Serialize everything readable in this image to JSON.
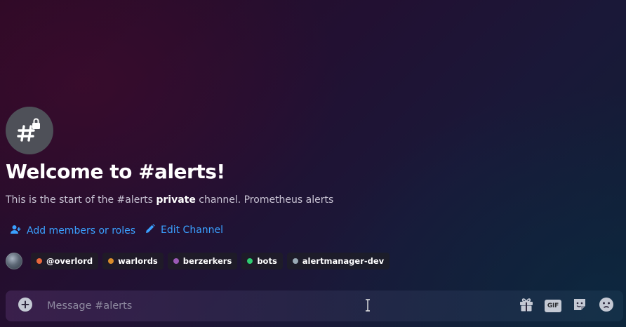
{
  "channel": {
    "name": "alerts",
    "icon": "hash-lock-icon",
    "welcome_title": "Welcome to #alerts!",
    "description_before": "This is the start of the #alerts ",
    "description_bold": "private",
    "description_after": " channel. Prometheus alerts"
  },
  "actions": {
    "add_members_label": "Add members or roles",
    "add_members_icon": "user-add-icon",
    "edit_channel_label": "Edit Channel",
    "edit_channel_icon": "pencil-icon",
    "color": "#3aa0ff"
  },
  "roles": [
    {
      "label": "@overlord",
      "color": "#e8673c"
    },
    {
      "label": "warlords",
      "color": "#d98c2b"
    },
    {
      "label": "berzerkers",
      "color": "#9b59b6"
    },
    {
      "label": "bots",
      "color": "#2ecc71"
    },
    {
      "label": "alertmanager-dev",
      "color": "#99aab5"
    }
  ],
  "composer": {
    "placeholder": "Message #alerts",
    "tools": [
      "gift-icon",
      "gif-icon",
      "sticker-icon",
      "emoji-icon"
    ],
    "gif_label": "GIF"
  }
}
